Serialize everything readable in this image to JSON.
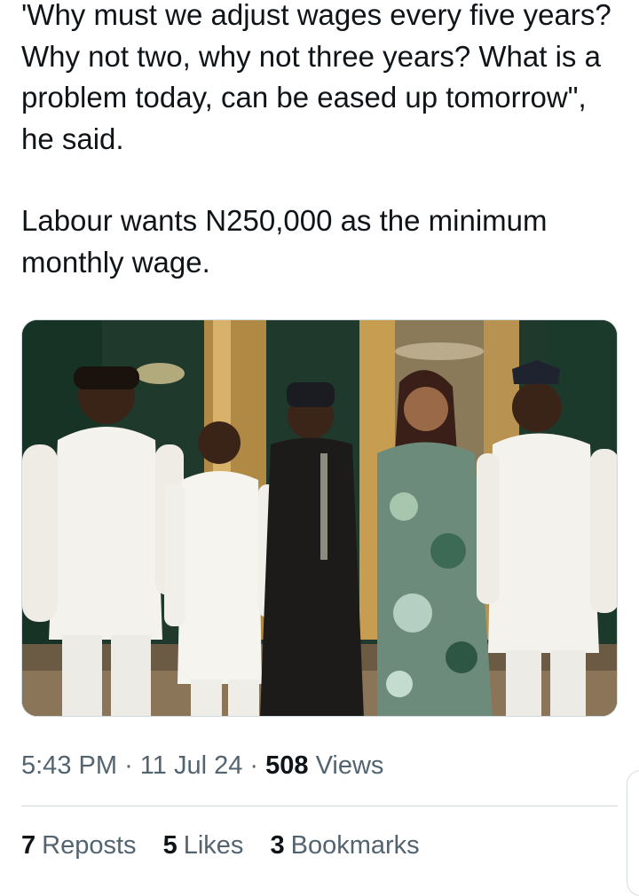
{
  "tweet": {
    "paragraphs": [
      "'Why must we adjust wages every five years? Why not two, why not three years? What is a problem today, can be eased up tomorrow\", he said.",
      "Labour wants N250,000 as the minimum monthly wage."
    ]
  },
  "meta": {
    "time": "5:43 PM",
    "separator": "·",
    "date": "11 Jul 24",
    "views_count": "508",
    "views_label": "Views"
  },
  "stats": [
    {
      "count": "7",
      "label": "Reposts"
    },
    {
      "count": "5",
      "label": "Likes"
    },
    {
      "count": "3",
      "label": "Bookmarks"
    }
  ],
  "colors": {
    "text": "#0f1419",
    "secondary": "#536471",
    "divider": "#cfd9de"
  }
}
